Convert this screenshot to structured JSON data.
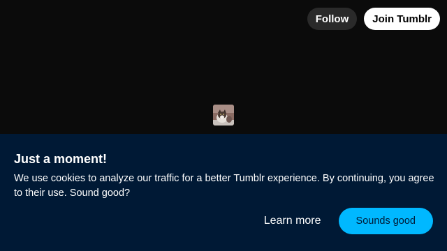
{
  "header": {
    "follow_label": "Follow",
    "join_label": "Join Tumblr"
  },
  "avatar": {
    "icon": "cat-avatar-icon"
  },
  "cookie_banner": {
    "title": "Just a moment!",
    "message": "We use cookies to analyze our traffic for a better Tumblr experience. By continuing, you agree to their use. Sound good?",
    "learn_more_label": "Learn more",
    "accept_label": "Sounds good",
    "colors": {
      "background": "#001935",
      "accent": "#00b8ff"
    }
  }
}
